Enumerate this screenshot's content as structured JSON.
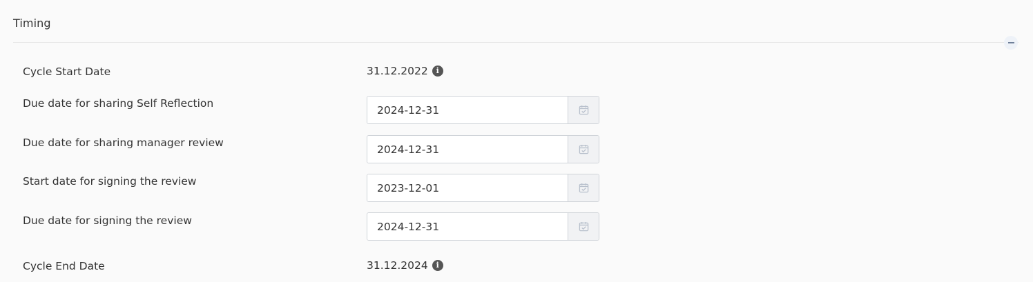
{
  "section": {
    "title": "Timing"
  },
  "rows": {
    "cycle_start": {
      "label": "Cycle Start Date",
      "value": "31.12.2022"
    },
    "self_reflection": {
      "label": "Due date for sharing Self Reflection",
      "value": "2024-12-31"
    },
    "manager_review": {
      "label": "Due date for sharing manager review",
      "value": "2024-12-31"
    },
    "start_signing": {
      "label": "Start date for signing the review",
      "value": "2023-12-01"
    },
    "due_signing": {
      "label": "Due date for signing the review",
      "value": "2024-12-31"
    },
    "cycle_end": {
      "label": "Cycle End Date",
      "value": "31.12.2024"
    }
  },
  "icons": {
    "info": "info-icon",
    "calendar": "calendar-check-icon",
    "collapse": "minus-icon"
  },
  "colors": {
    "background": "#fafafa",
    "text": "#333333",
    "info_icon": "#555555",
    "calendar_icon": "#b8c0cc",
    "field_border": "#cfd3d8",
    "addon_bg": "#f1f2f4"
  }
}
